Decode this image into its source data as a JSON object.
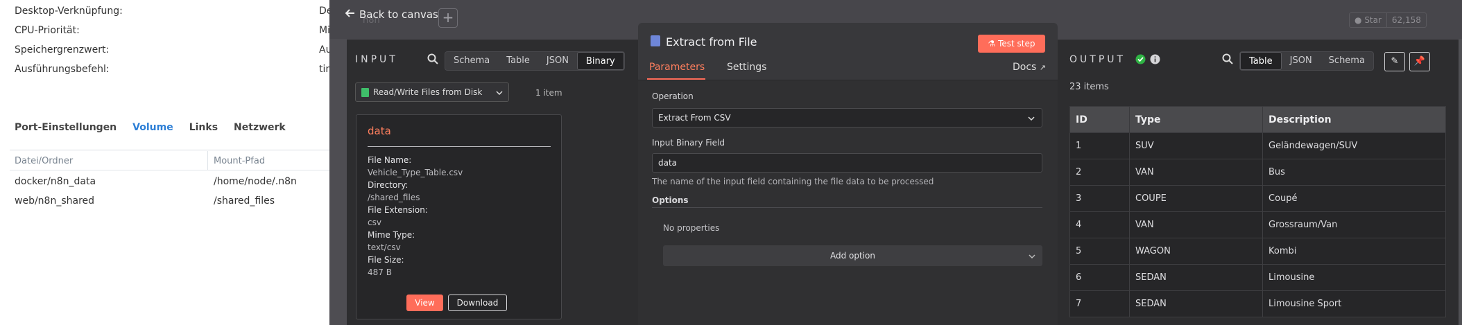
{
  "background": {
    "settings": [
      {
        "label": "Desktop-Verknüpfung:",
        "value": "De"
      },
      {
        "label": "CPU-Priorität:",
        "value": "Mi"
      },
      {
        "label": "Speichergrenzwert:",
        "value": "Au"
      },
      {
        "label": "Ausführungsbefehl:",
        "value": "tin"
      }
    ],
    "tabs": [
      "Port-Einstellungen",
      "Volume",
      "Links",
      "Netzwerk"
    ],
    "active_tab": "Volume",
    "columns": [
      "Datei/Ordner",
      "Mount-Pfad"
    ],
    "rows": [
      [
        "docker/n8n_data",
        "/home/node/.n8n"
      ],
      [
        "web/n8n_shared",
        "/shared_files"
      ]
    ]
  },
  "overlay": {
    "back_label": "Back to canvas",
    "plus_label": "+",
    "logo_ghost": "n8n",
    "github": {
      "star": "Star",
      "count": "62,158"
    }
  },
  "input": {
    "title": "INPUT",
    "views": [
      "Schema",
      "Table",
      "JSON",
      "Binary"
    ],
    "active_view": "Binary",
    "node_select": "Read/Write Files from Disk",
    "item_count": "1 item",
    "card": {
      "title": "data",
      "fields": [
        {
          "key": "File Name:",
          "value": "Vehicle_Type_Table.csv"
        },
        {
          "key": "Directory:",
          "value": "/shared_files"
        },
        {
          "key": "File Extension:",
          "value": "csv"
        },
        {
          "key": "Mime Type:",
          "value": "text/csv"
        },
        {
          "key": "File Size:",
          "value": "487 B"
        }
      ],
      "view_label": "View",
      "download_label": "Download"
    }
  },
  "node": {
    "title": "Extract from File",
    "test_step": "Test step",
    "tabs": {
      "parameters": "Parameters",
      "settings": "Settings",
      "docs": "Docs"
    },
    "operation_label": "Operation",
    "operation_value": "Extract From CSV",
    "binary_field_label": "Input Binary Field",
    "binary_field_value": "data",
    "binary_field_hint": "The name of the input field containing the file data to be processed",
    "options_label": "Options",
    "no_properties": "No properties",
    "add_option": "Add option"
  },
  "output": {
    "title": "OUTPUT",
    "views": [
      "Table",
      "JSON",
      "Schema"
    ],
    "active_view": "Table",
    "items_count": "23 items",
    "columns": [
      "ID",
      "Type",
      "Description"
    ],
    "rows": [
      [
        "1",
        "SUV",
        "Geländewagen/SUV"
      ],
      [
        "2",
        "VAN",
        "Bus"
      ],
      [
        "3",
        "COUPE",
        "Coupé"
      ],
      [
        "4",
        "VAN",
        "Grossraum/Van"
      ],
      [
        "5",
        "WAGON",
        "Kombi"
      ],
      [
        "6",
        "SEDAN",
        "Limousine"
      ],
      [
        "7",
        "SEDAN",
        "Limousine Sport"
      ]
    ]
  },
  "colors": {
    "accent": "#ff6d5a",
    "success": "#2fb344",
    "link_blue": "#2d7fd6"
  }
}
